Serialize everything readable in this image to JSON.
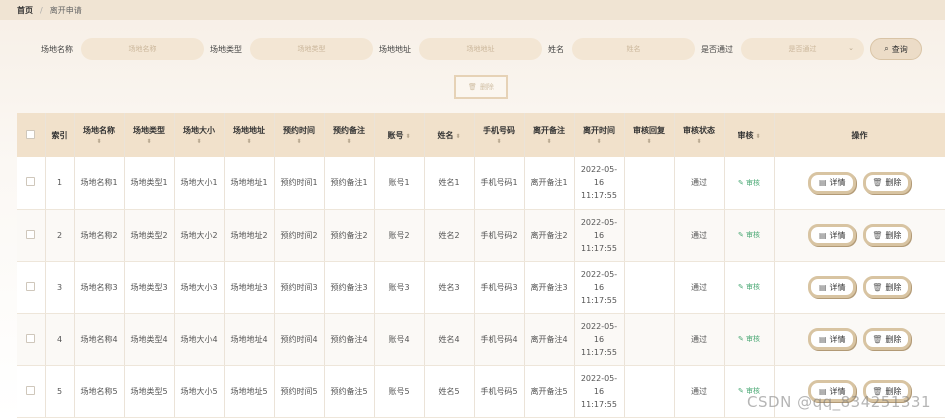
{
  "breadcrumb": {
    "home": "首页",
    "current": "离开申请"
  },
  "search": {
    "field1_label": "场地名称",
    "field1_placeholder": "场地名称",
    "field2_label": "场地类型",
    "field2_placeholder": "场地类型",
    "field3_label": "场地地址",
    "field3_placeholder": "场地地址",
    "field4_label": "姓名",
    "field4_placeholder": "姓名",
    "field5_label": "是否通过",
    "field5_placeholder": "是否通过",
    "search_button": "查询"
  },
  "toolbar": {
    "delete_label": "删除"
  },
  "table": {
    "headers": [
      "索引",
      "场地名称",
      "场地类型",
      "场地大小",
      "场地地址",
      "预约时间",
      "预约备注",
      "账号",
      "姓名",
      "手机号码",
      "离开备注",
      "离开时间",
      "审核回复",
      "审核状态",
      "审核",
      "操作"
    ],
    "rows": [
      {
        "index": "1",
        "name": "场地名称1",
        "type": "场地类型1",
        "size": "场地大小1",
        "addr": "场地地址1",
        "time": "预约时间1",
        "remark": "预约备注1",
        "account": "账号1",
        "person": "姓名1",
        "phone": "手机号码1",
        "leave_remark": "离开备注1",
        "leave_time": "2022-05-16 11:17:55",
        "reply": "",
        "status": "通过",
        "audit": "审核",
        "detail": "详情",
        "delete": "删除"
      },
      {
        "index": "2",
        "name": "场地名称2",
        "type": "场地类型2",
        "size": "场地大小2",
        "addr": "场地地址2",
        "time": "预约时间2",
        "remark": "预约备注2",
        "account": "账号2",
        "person": "姓名2",
        "phone": "手机号码2",
        "leave_remark": "离开备注2",
        "leave_time": "2022-05-16 11:17:55",
        "reply": "",
        "status": "通过",
        "audit": "审核",
        "detail": "详情",
        "delete": "删除"
      },
      {
        "index": "3",
        "name": "场地名称3",
        "type": "场地类型3",
        "size": "场地大小3",
        "addr": "场地地址3",
        "time": "预约时间3",
        "remark": "预约备注3",
        "account": "账号3",
        "person": "姓名3",
        "phone": "手机号码3",
        "leave_remark": "离开备注3",
        "leave_time": "2022-05-16 11:17:55",
        "reply": "",
        "status": "通过",
        "audit": "审核",
        "detail": "详情",
        "delete": "删除"
      },
      {
        "index": "4",
        "name": "场地名称4",
        "type": "场地类型4",
        "size": "场地大小4",
        "addr": "场地地址4",
        "time": "预约时间4",
        "remark": "预约备注4",
        "account": "账号4",
        "person": "姓名4",
        "phone": "手机号码4",
        "leave_remark": "离开备注4",
        "leave_time": "2022-05-16 11:17:55",
        "reply": "",
        "status": "通过",
        "audit": "审核",
        "detail": "详情",
        "delete": "删除"
      },
      {
        "index": "5",
        "name": "场地名称5",
        "type": "场地类型5",
        "size": "场地大小5",
        "addr": "场地地址5",
        "time": "预约时间5",
        "remark": "预约备注5",
        "account": "账号5",
        "person": "姓名5",
        "phone": "手机号码5",
        "leave_remark": "离开备注5",
        "leave_time": "2022-05-16 11:17:55",
        "reply": "",
        "status": "通过",
        "audit": "审核",
        "detail": "详情",
        "delete": "删除"
      }
    ]
  },
  "watermark": "CSDN @qq_834251331"
}
